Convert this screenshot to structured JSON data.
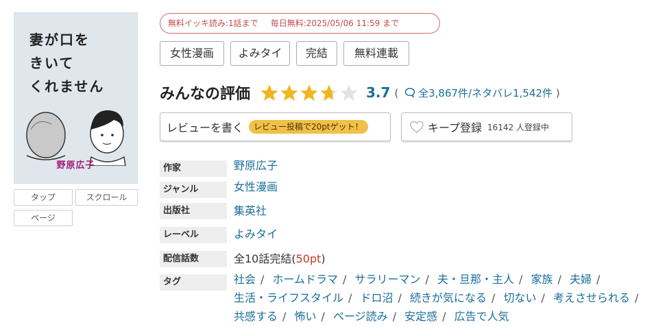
{
  "cover": {
    "title_lines": [
      "妻が口を",
      "きいて",
      "くれません"
    ],
    "author": "野原広子"
  },
  "view_modes": {
    "tap": "タップ",
    "scroll": "スクロール",
    "page": "ページ"
  },
  "campaign": {
    "free_bulk": "無料イッキ読み:1話まで",
    "daily_free": "毎日無料:2025/05/06 11:59 まで"
  },
  "genre_tags": [
    "女性漫画",
    "よみタイ",
    "完結",
    "無料連載"
  ],
  "rating": {
    "label": "みんなの評価",
    "value": "3.7",
    "stars_filled": 3.7,
    "stars_max": 5,
    "open_paren": "(",
    "counts": "全3,867件/ネタバレ1,542件",
    "close_paren": ")",
    "star_color": "#f2b51f",
    "star_empty_color": "#e3e3e3"
  },
  "review_button": {
    "label": "レビューを書く",
    "promo": "レビュー投稿で20ptゲット！"
  },
  "keep_button": {
    "label": "キープ登録",
    "count": "16142 人登録中"
  },
  "info": {
    "author_label": "作家",
    "author_value": "野原広子",
    "genre_label": "ジャンル",
    "genre_value": "女性漫画",
    "publisher_label": "出版社",
    "publisher_value": "集英社",
    "label_label": "レーベル",
    "label_value": "よみタイ",
    "episodes_label": "配信話数",
    "episodes_value": "全10話完結",
    "episodes_pt_open": "(",
    "episodes_pt": "50pt",
    "episodes_pt_close": ")",
    "tags_label": "タグ",
    "tags": [
      "社会",
      "ホームドラマ",
      "サラリーマン",
      "夫・旦那・主人",
      "家族",
      "夫婦",
      "生活・ライフスタイル",
      "ドロ沼",
      "続きが気になる",
      "切ない",
      "考えさせられる",
      "共感する",
      "怖い",
      "ページ読み",
      "安定感",
      "広告で人気"
    ],
    "tag_separator": "/"
  },
  "colors": {
    "link": "#1a6f9a",
    "campaign": "#c94a4a",
    "promo_badge": "#f0c048",
    "pt_red": "#c0392b"
  }
}
